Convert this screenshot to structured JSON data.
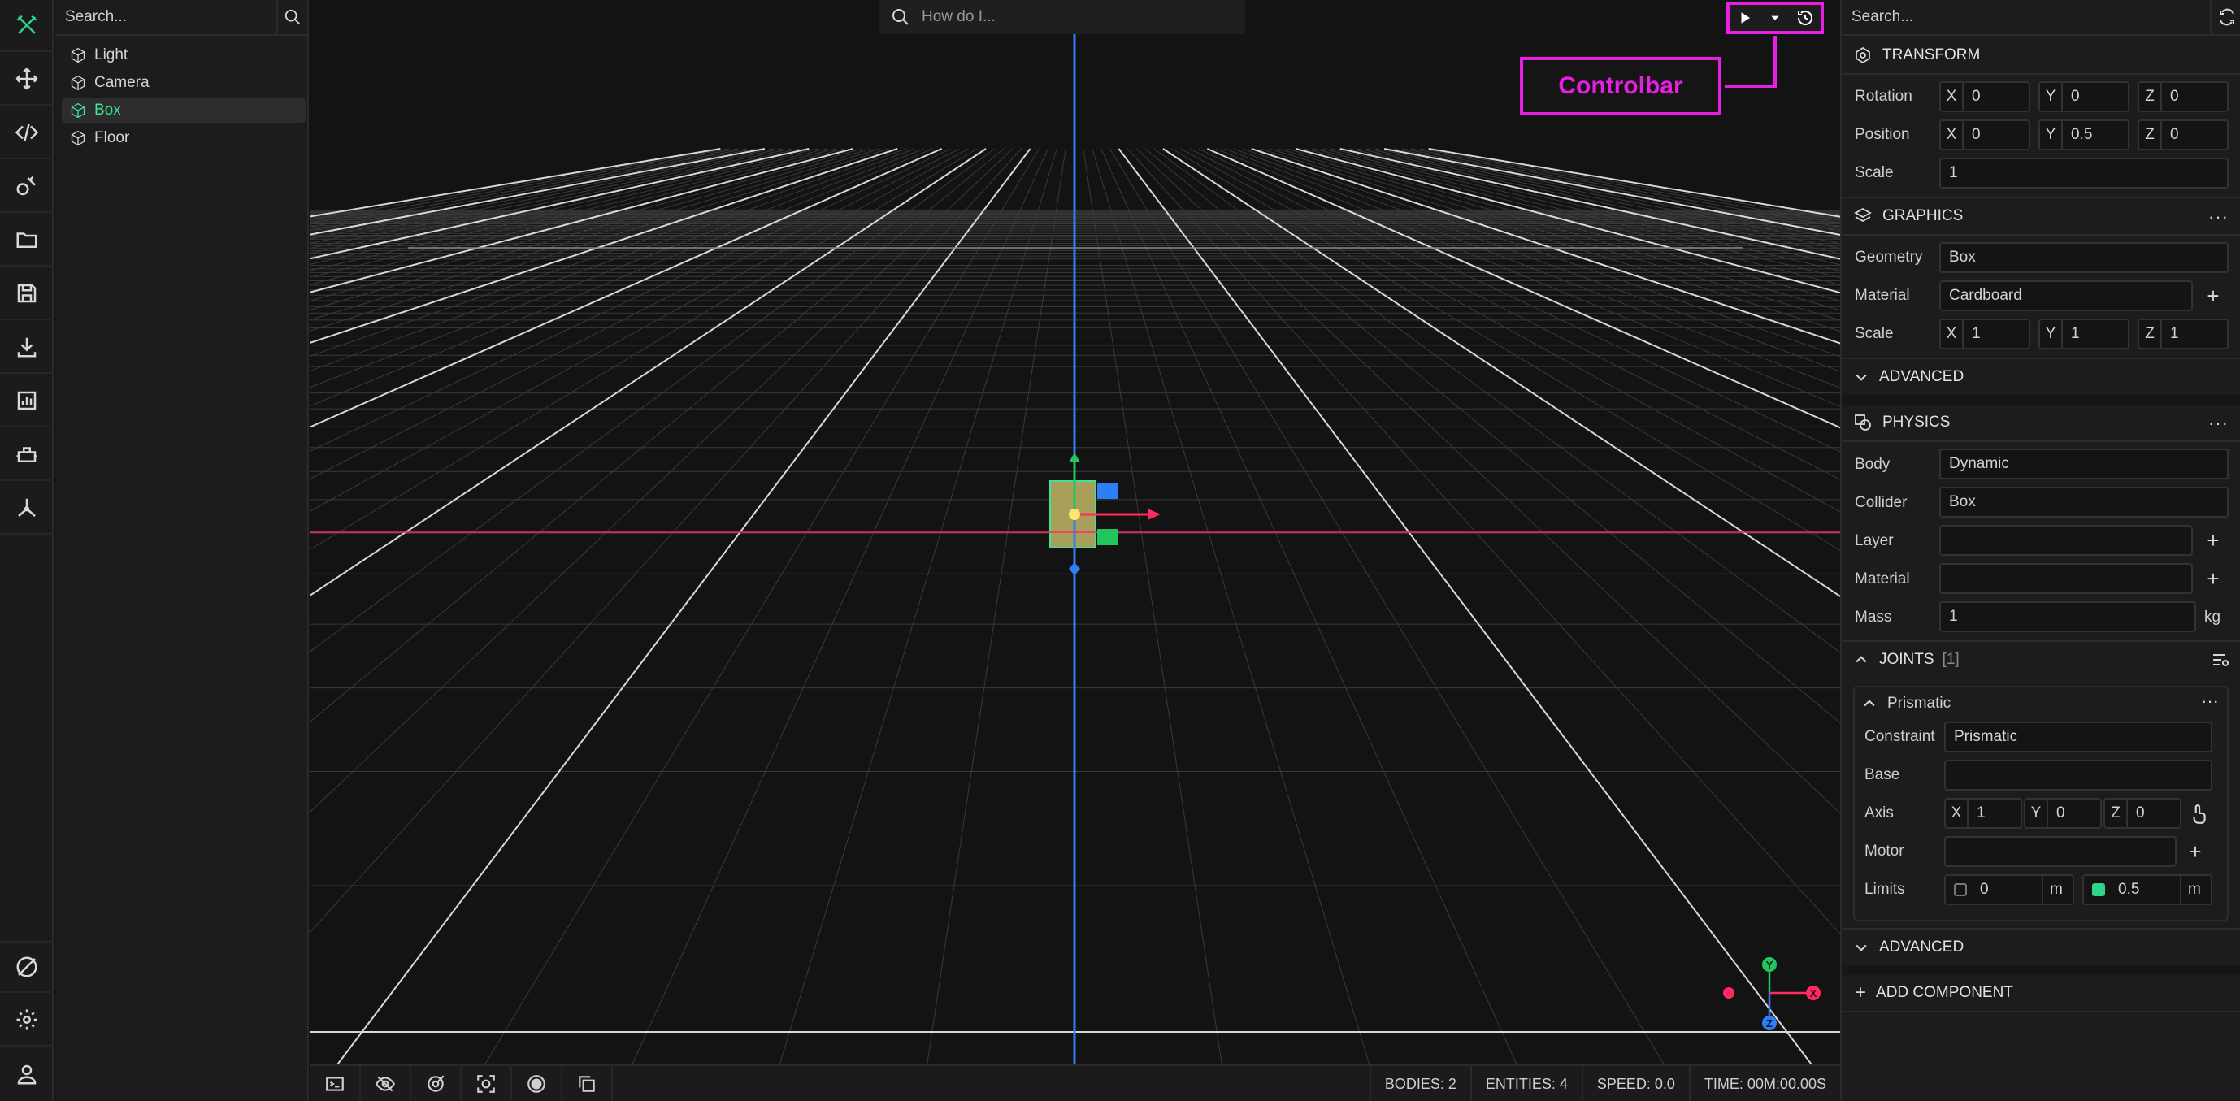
{
  "hierarchy": {
    "search_placeholder": "Search...",
    "items": [
      {
        "label": "Light",
        "selected": false
      },
      {
        "label": "Camera",
        "selected": false
      },
      {
        "label": "Box",
        "selected": true
      },
      {
        "label": "Floor",
        "selected": false
      }
    ]
  },
  "viewport": {
    "ask_placeholder": "How do I...",
    "callout_label": "Controlbar",
    "gizmo": {
      "y": "Y",
      "x": "X",
      "z": "Z"
    },
    "stats": {
      "bodies": "BODIES: 2",
      "entities": "ENTITIES: 4",
      "speed": "SPEED: 0.0",
      "time": "TIME: 00M:00.00S"
    }
  },
  "inspector": {
    "search_placeholder": "Search...",
    "transform": {
      "title": "TRANSFORM",
      "rotation_label": "Rotation",
      "rotation": {
        "x": "0",
        "y": "0",
        "z": "0"
      },
      "position_label": "Position",
      "position": {
        "x": "0",
        "y": "0.5",
        "z": "0"
      },
      "scale_label": "Scale",
      "scale": "1"
    },
    "graphics": {
      "title": "GRAPHICS",
      "geometry_label": "Geometry",
      "geometry": "Box",
      "material_label": "Material",
      "material": "Cardboard",
      "scale_label": "Scale",
      "scale": {
        "x": "1",
        "y": "1",
        "z": "1"
      },
      "advanced": "ADVANCED"
    },
    "physics": {
      "title": "PHYSICS",
      "body_label": "Body",
      "body": "Dynamic",
      "collider_label": "Collider",
      "collider": "Box",
      "layer_label": "Layer",
      "layer": "",
      "material_label": "Material",
      "material": "",
      "mass_label": "Mass",
      "mass": "1",
      "mass_unit": "kg"
    },
    "joints": {
      "title": "JOINTS",
      "count": "[1]",
      "joint": {
        "name": "Prismatic",
        "constraint_label": "Constraint",
        "constraint": "Prismatic",
        "base_label": "Base",
        "base": "",
        "axis_label": "Axis",
        "axis": {
          "x": "1",
          "y": "0",
          "z": "0"
        },
        "motor_label": "Motor",
        "motor": "",
        "limits_label": "Limits",
        "limit_min": "0",
        "limit_min_unit": "m",
        "limit_min_enabled": false,
        "limit_max": "0.5",
        "limit_max_unit": "m",
        "limit_max_enabled": true
      },
      "advanced": "ADVANCED"
    },
    "add_component": "ADD COMPONENT"
  },
  "axis_letters": {
    "x": "X",
    "y": "Y",
    "z": "Z"
  },
  "colors": {
    "accent": "#2fd68a",
    "callout": "#e81ee4",
    "axis_x": "#ff2a5f",
    "axis_y": "#22c55e",
    "axis_z": "#2d7ff9"
  }
}
